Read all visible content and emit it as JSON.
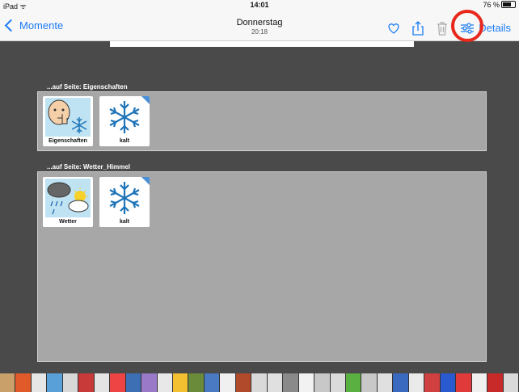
{
  "status": {
    "carrier": "iPad",
    "time": "14:01",
    "battery": "76 %"
  },
  "nav": {
    "back_label": "Momente",
    "title": "Donnerstag",
    "subtitle": "20:18",
    "details_label": "Details"
  },
  "sections": [
    {
      "label": "...auf Seite: Eigenschaften",
      "tiles": [
        {
          "label": "Eigenschaften",
          "icon": "eigenschaften-symbol"
        },
        {
          "label": "kalt",
          "icon": "snowflake-icon"
        }
      ]
    },
    {
      "label": "...auf Seite: Wetter_Himmel",
      "tiles": [
        {
          "label": "Wetter",
          "icon": "weather-icon"
        },
        {
          "label": "kalt",
          "icon": "snowflake-icon"
        }
      ]
    }
  ],
  "colors": {
    "accent": "#1a7cf5",
    "highlight": "#e8281d",
    "background": "#4a4a4a",
    "panel": "#a7a7a7",
    "symbol_tile": "#bfe3f2"
  },
  "thumbnail_colors": [
    "#c9a06a",
    "#e05a2a",
    "#e6e6e6",
    "#5aa0d8",
    "#d8d8d8",
    "#c83a3a",
    "#e4e4e4",
    "#e44",
    "#3c6fb4",
    "#9a7ac8",
    "#e8e8e8",
    "#f2c030",
    "#6a8b3a",
    "#4a7ac2",
    "#f0f0f0",
    "#b04a2a",
    "#d9d9d9",
    "#e0e0e0",
    "#8a8a8a",
    "#f2f2f2",
    "#c8c8c8",
    "#dadada",
    "#5ab040",
    "#c8c8c8",
    "#e0e0e0",
    "#3a6ac0",
    "#eaeaea",
    "#d04040",
    "#2a5ad0",
    "#e03a3a",
    "#f0f0f0",
    "#c82a2a",
    "#dadada"
  ]
}
